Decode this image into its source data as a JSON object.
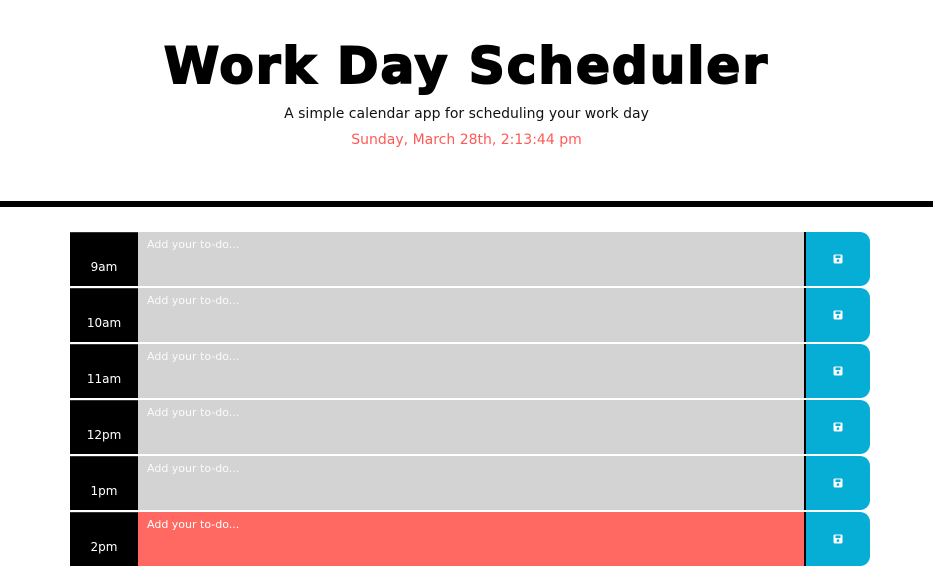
{
  "header": {
    "title": "Work Day Scheduler",
    "subtitle": "A simple calendar app for scheduling your work day",
    "current_day": "Sunday, March 28th, 2:13:44 pm"
  },
  "schedule": {
    "placeholder": "Add your to-do...",
    "rows": [
      {
        "hour": "9am",
        "value": "",
        "state": "past"
      },
      {
        "hour": "10am",
        "value": "",
        "state": "past"
      },
      {
        "hour": "11am",
        "value": "",
        "state": "past"
      },
      {
        "hour": "12pm",
        "value": "",
        "state": "past"
      },
      {
        "hour": "1pm",
        "value": "",
        "state": "past"
      },
      {
        "hour": "2pm",
        "value": "",
        "state": "present"
      }
    ],
    "save_icon": "save-icon"
  },
  "colors": {
    "past": "#d3d3d3",
    "present": "#ff6961",
    "save_button": "#06aed5",
    "current_day_text": "#ff5a55"
  }
}
